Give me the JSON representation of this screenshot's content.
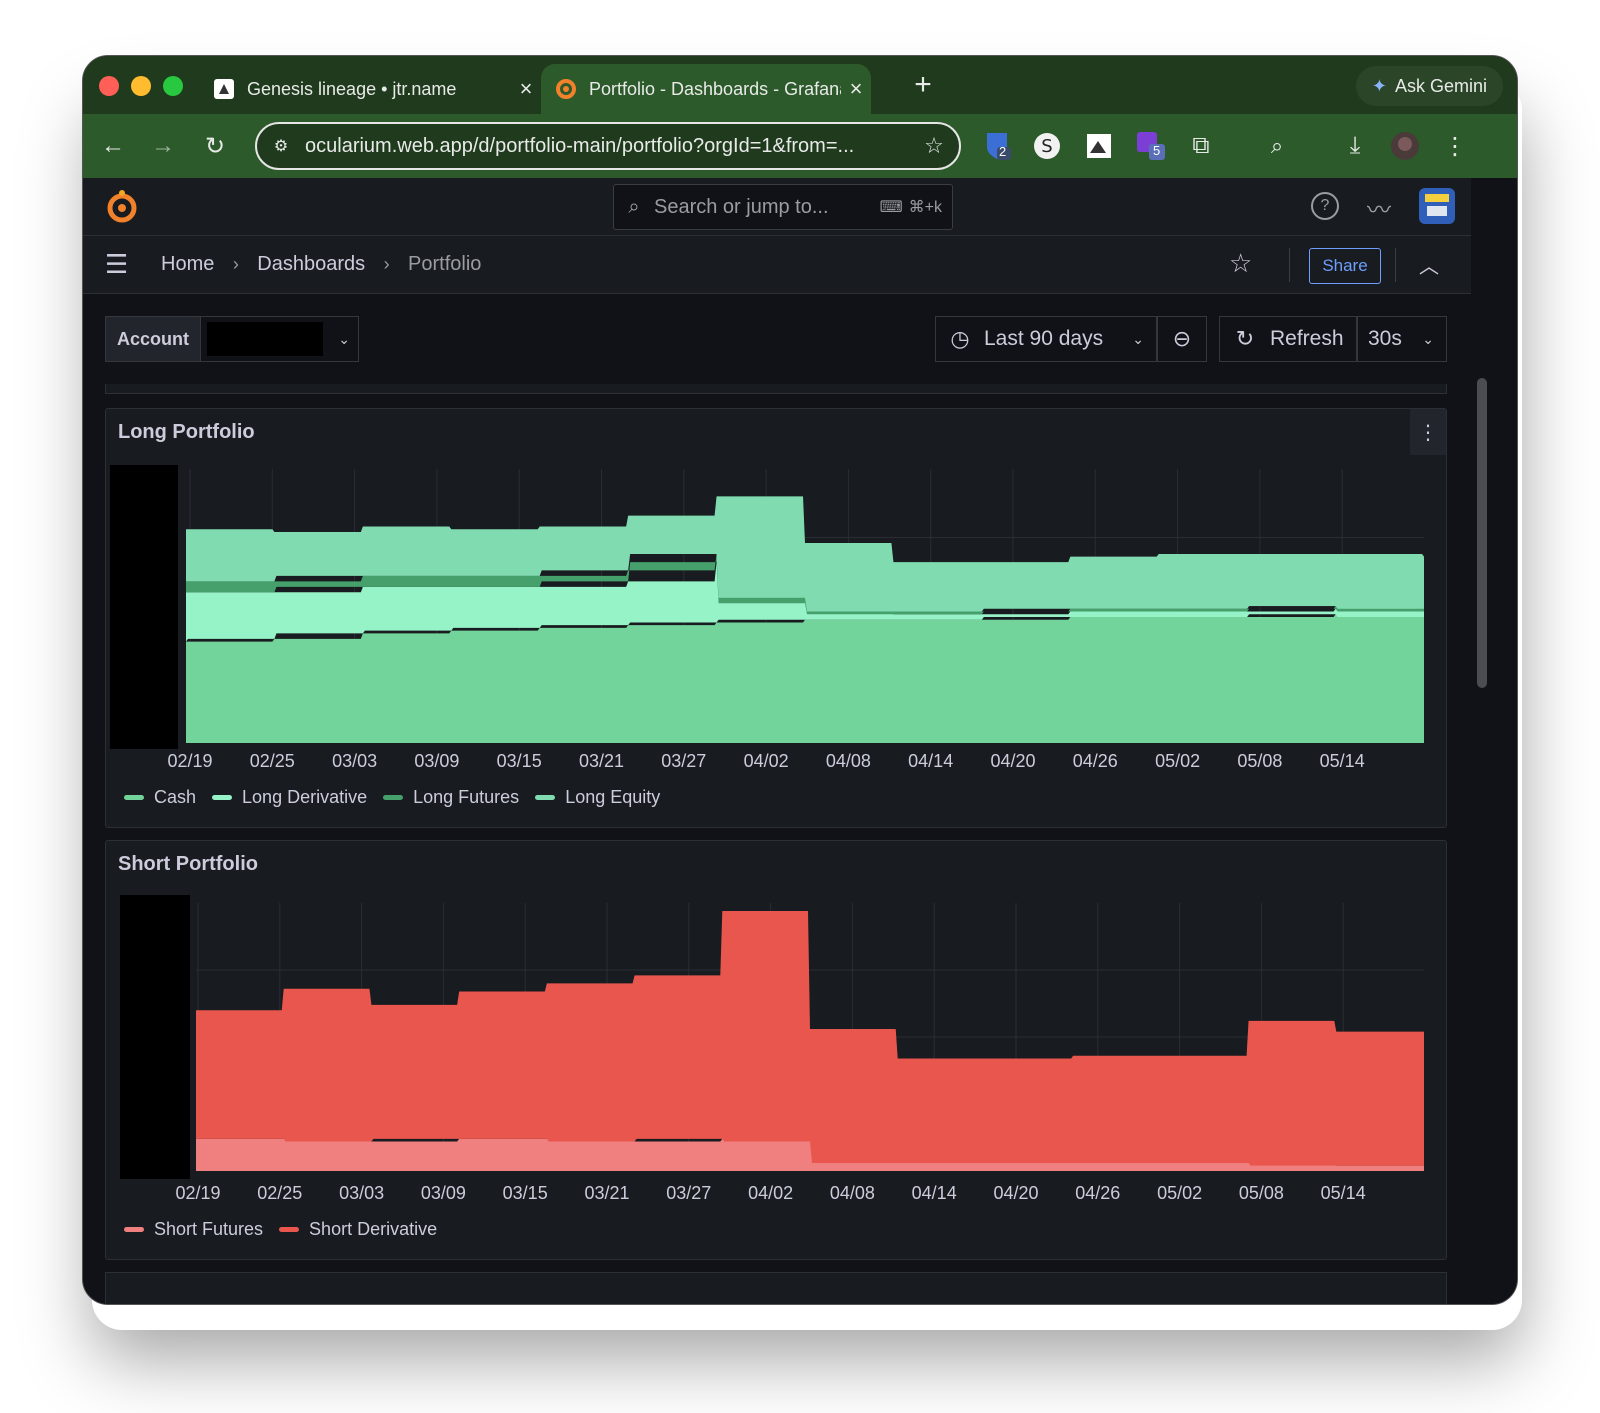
{
  "browser": {
    "tabs": [
      {
        "title": "Genesis lineage • jtr.name",
        "icon": "github-icon"
      },
      {
        "title": "Portfolio - Dashboards - Grafana",
        "icon": "grafana-icon"
      }
    ],
    "gemini_label": "Ask Gemini",
    "url": "ocularium.web.app/d/portfolio-main/portfolio?orgId=1&from=...",
    "extension_badges": [
      "2",
      "5"
    ]
  },
  "grafana": {
    "search_placeholder": "Search or jump to...",
    "search_shortcut": "⌘+k",
    "breadcrumb": [
      "Home",
      "Dashboards",
      "Portfolio"
    ],
    "share_label": "Share",
    "variable_label": "Account",
    "time_range": "Last 90 days",
    "refresh_label": "Refresh",
    "refresh_interval": "30s"
  },
  "panels": [
    {
      "title": "Long Portfolio",
      "legend": [
        {
          "name": "Cash",
          "color": "#73d49b"
        },
        {
          "name": "Long Derivative",
          "color": "#96f2c7"
        },
        {
          "name": "Long Futures",
          "color": "#46a06c"
        },
        {
          "name": "Long Equity",
          "color": "#80dcb0"
        }
      ]
    },
    {
      "title": "Short Portfolio",
      "legend": [
        {
          "name": "Short Futures",
          "color": "#f08080"
        },
        {
          "name": "Short Derivative",
          "color": "#e8564d"
        }
      ]
    }
  ],
  "chart_data": [
    {
      "type": "area",
      "title": "Long Portfolio",
      "x_ticks": [
        "02/19",
        "02/25",
        "03/03",
        "03/09",
        "03/15",
        "03/21",
        "03/27",
        "04/02",
        "04/08",
        "04/14",
        "04/20",
        "04/26",
        "05/02",
        "05/08",
        "05/14"
      ],
      "stacked": true,
      "series": [
        {
          "name": "Cash",
          "values": [
            0.37,
            0.38,
            0.4,
            0.41,
            0.42,
            0.43,
            0.44,
            0.45,
            0.45,
            0.45,
            0.46,
            0.46,
            0.46,
            0.47,
            0.46
          ]
        },
        {
          "name": "Long Derivative",
          "values": [
            0.18,
            0.17,
            0.17,
            0.16,
            0.15,
            0.16,
            0.22,
            0.06,
            0.02,
            0.02,
            0.02,
            0.02,
            0.02,
            0.02,
            0.02
          ]
        },
        {
          "name": "Long Futures",
          "values": [
            0.04,
            0.04,
            0.04,
            0.04,
            0.04,
            0.04,
            0.03,
            0.02,
            0.01,
            0.01,
            0.01,
            0.01,
            0.01,
            0.01,
            0.01
          ]
        },
        {
          "name": "Long Equity",
          "values": [
            0.19,
            0.18,
            0.18,
            0.17,
            0.18,
            0.2,
            0.21,
            0.2,
            0.18,
            0.18,
            0.19,
            0.2,
            0.2,
            0.19,
            0.19
          ]
        }
      ]
    },
    {
      "type": "area",
      "title": "Short Portfolio",
      "x_ticks": [
        "02/19",
        "02/25",
        "03/03",
        "03/09",
        "03/15",
        "03/21",
        "03/27",
        "04/02",
        "04/08",
        "04/14",
        "04/20",
        "04/26",
        "05/02",
        "05/08",
        "05/14"
      ],
      "stacked": true,
      "series": [
        {
          "name": "Short Futures",
          "values": [
            0.12,
            0.12,
            0.11,
            0.12,
            0.12,
            0.11,
            0.12,
            0.11,
            0.03,
            0.03,
            0.03,
            0.03,
            0.03,
            0.02,
            0.02
          ]
        },
        {
          "name": "Short Derivative",
          "values": [
            0.48,
            0.56,
            0.51,
            0.55,
            0.58,
            0.62,
            0.85,
            0.42,
            0.39,
            0.39,
            0.4,
            0.4,
            0.53,
            0.5,
            0.5
          ]
        }
      ]
    }
  ]
}
